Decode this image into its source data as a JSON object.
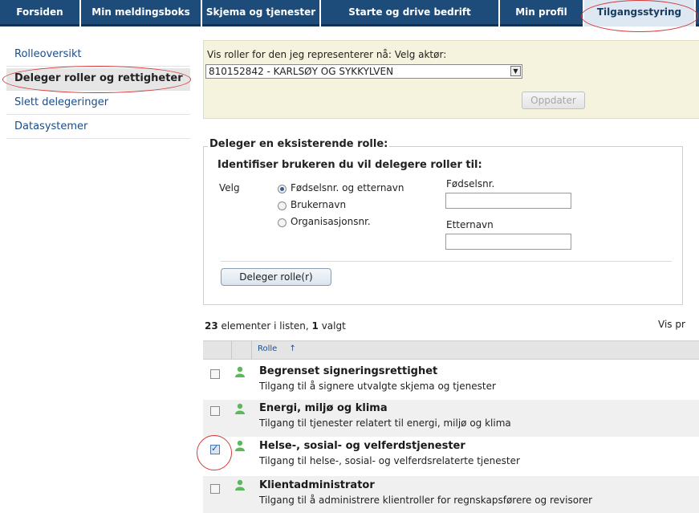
{
  "nav": {
    "tabs": [
      {
        "label": "Forsiden"
      },
      {
        "label": "Min meldingsboks"
      },
      {
        "label": "Skjema og tjenester"
      },
      {
        "label": "Starte og drive bedrift"
      },
      {
        "label": "Min profil"
      },
      {
        "label": "Tilgangsstyring"
      }
    ],
    "active_tab": "Tilgangsstyring"
  },
  "sidebar": {
    "items": [
      {
        "label": "Rolleoversikt"
      },
      {
        "label": "Deleger roller og rettigheter"
      },
      {
        "label": "Slett delegeringer"
      },
      {
        "label": "Datasystemer"
      }
    ]
  },
  "actor": {
    "label": "Vis roller for den jeg representerer nå: Velg aktør:",
    "selected": "810152842 - KARLSØY OG SYKKYLVEN",
    "update_button": "Oppdater"
  },
  "delegate": {
    "legend": "Deleger en eksisterende rolle:",
    "heading": "Identifiser brukeren du vil delegere roller til:",
    "choose_label": "Velg",
    "options": [
      {
        "label": "Fødselsnr. og etternavn",
        "checked": true
      },
      {
        "label": "Brukernavn",
        "checked": false
      },
      {
        "label": "Organisasjonsnr.",
        "checked": false
      }
    ],
    "field1_label": "Fødselsnr.",
    "field2_label": "Etternavn",
    "field1_value": "",
    "field2_value": "",
    "button": "Deleger rolle(r)"
  },
  "list": {
    "count": "23",
    "count_text": " elementer i listen, ",
    "selected": "1",
    "selected_text": " valgt",
    "right_text": "Vis pr",
    "column_header": "Rolle",
    "sort_icon": "↑",
    "rows": [
      {
        "title": "Begrenset signeringsrettighet",
        "desc": "Tilgang til å signere utvalgte skjema og tjenester",
        "checked": false
      },
      {
        "title": "Energi, miljø og klima",
        "desc": "Tilgang til tjenester relatert til energi, miljø og klima",
        "checked": false
      },
      {
        "title": "Helse-, sosial- og velferdstjenester",
        "desc": "Tilgang til helse-, sosial- og velferdsrelaterte tjenester",
        "checked": true
      },
      {
        "title": "Klientadministrator",
        "desc": "Tilgang til å administrere klientroller for regnskapsførere og revisorer",
        "checked": false
      }
    ]
  },
  "colors": {
    "nav_bg": "#1e4c7a",
    "active_tab_bg": "#dde8f3",
    "link": "#1a4d8a",
    "panel_bg": "#f5f2de",
    "annotation": "#d33a3a",
    "person_icon": "#5cb85c"
  }
}
